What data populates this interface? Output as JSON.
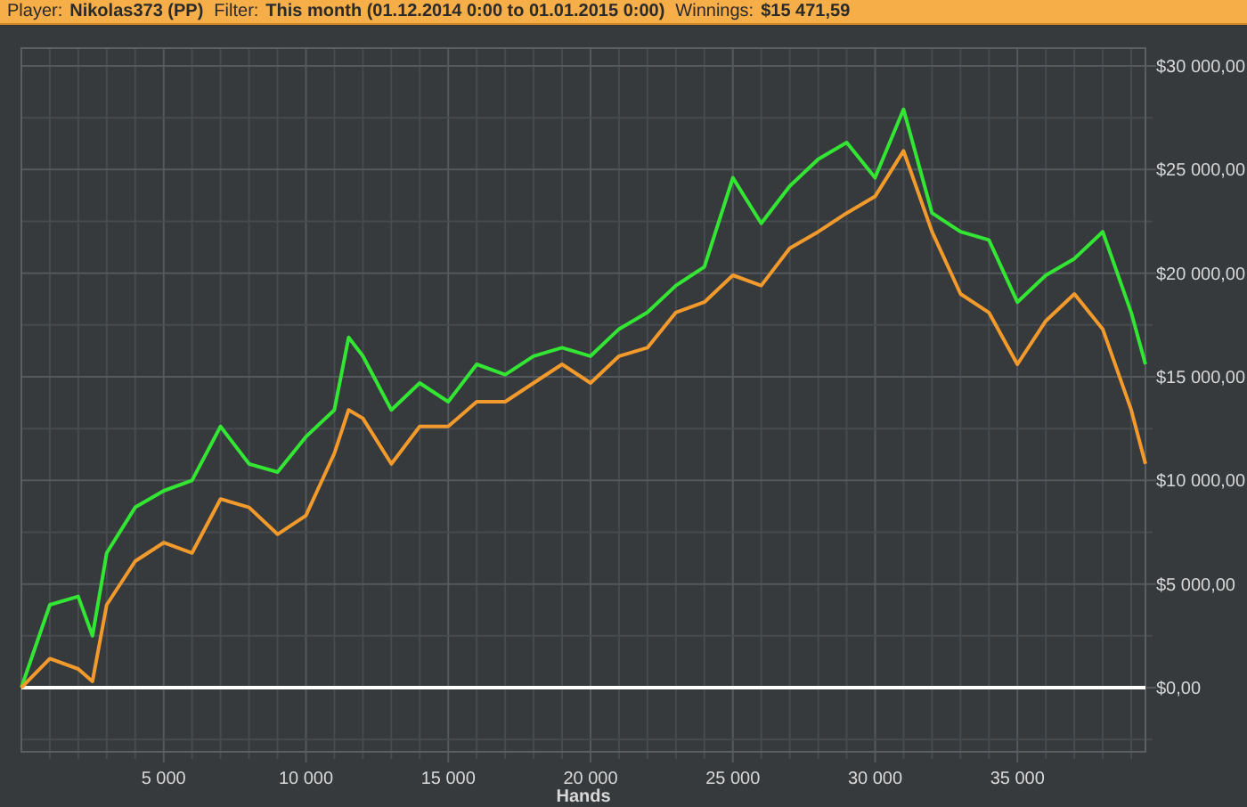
{
  "header": {
    "fields": [
      {
        "label": "Player:",
        "value": "Nikolas373 (PP)"
      },
      {
        "label": "Filter:",
        "value": "This month (01.12.2014 0:00 to 01.01.2015 0:00)"
      },
      {
        "label": "Winnings:",
        "value": "$15 471,59"
      }
    ]
  },
  "chart": {
    "chart_data": {
      "type": "line",
      "grid": true,
      "xlabel": "Hands",
      "x": [
        0,
        1000,
        2000,
        2500,
        3000,
        4000,
        5000,
        6000,
        7000,
        8000,
        9000,
        10000,
        11000,
        11500,
        12000,
        13000,
        14000,
        15000,
        16000,
        17000,
        18000,
        19000,
        20000,
        21000,
        22000,
        23000,
        24000,
        25000,
        26000,
        27000,
        28000,
        29000,
        30000,
        31000,
        32000,
        33000,
        34000,
        35000,
        36000,
        37000,
        38000,
        39000,
        39500
      ],
      "series": [
        {
          "color": "#33e633",
          "values": [
            0,
            4000,
            4400,
            2500,
            6500,
            8700,
            9500,
            10000,
            12600,
            10800,
            10400,
            12100,
            13400,
            16900,
            16000,
            13400,
            14700,
            13800,
            15600,
            15100,
            16000,
            16400,
            16000,
            17300,
            18100,
            19400,
            20300,
            24600,
            22400,
            24200,
            25500,
            26300,
            24600,
            27900,
            22900,
            22000,
            21600,
            18600,
            19900,
            20700,
            22000,
            18100,
            15600
          ]
        },
        {
          "color": "#f39a2c",
          "values": [
            0,
            1400,
            900,
            300,
            4000,
            6100,
            7000,
            6500,
            9100,
            8700,
            7400,
            8300,
            11300,
            13400,
            13000,
            10800,
            12600,
            12600,
            13800,
            13800,
            14700,
            15600,
            14700,
            16000,
            16400,
            18100,
            18600,
            19900,
            19400,
            21200,
            22000,
            22900,
            23700,
            25900,
            22000,
            19000,
            18100,
            15600,
            17700,
            19000,
            17300,
            13400,
            10800
          ]
        }
      ],
      "xlim": [
        0,
        39500
      ],
      "ylim": [
        -3095,
        30860
      ],
      "xticks": [
        {
          "value": 5000,
          "label": "5 000"
        },
        {
          "value": 10000,
          "label": "10 000"
        },
        {
          "value": 15000,
          "label": "15 000"
        },
        {
          "value": 20000,
          "label": "20 000"
        },
        {
          "value": 25000,
          "label": "25 000"
        },
        {
          "value": 30000,
          "label": "30 000"
        },
        {
          "value": 35000,
          "label": "35 000"
        }
      ],
      "yticks": [
        {
          "value": 0,
          "label": "$0,00"
        },
        {
          "value": 5000,
          "label": "$5 000,00"
        },
        {
          "value": 10000,
          "label": "$10 000,00"
        },
        {
          "value": 15000,
          "label": "$15 000,00"
        },
        {
          "value": 20000,
          "label": "$20 000,00"
        },
        {
          "value": 25000,
          "label": "$25 000,00"
        },
        {
          "value": 30000,
          "label": "$30 000,00"
        }
      ]
    }
  }
}
